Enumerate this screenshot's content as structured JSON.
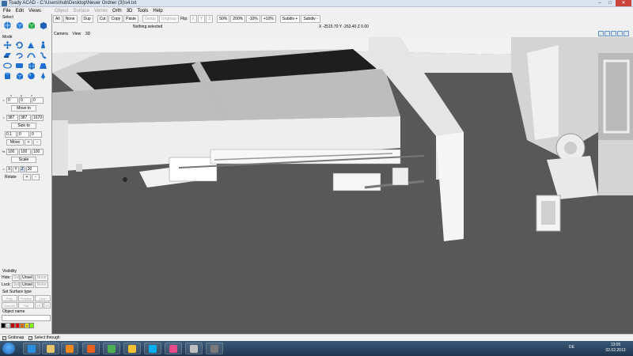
{
  "window": {
    "title": "Toady ACAD - C:\\Users\\hub\\Desktop\\Neuer Ordner (3)\\s4.txt",
    "minimize_glyph": "–",
    "maximize_glyph": "□",
    "close_glyph": "✕"
  },
  "menu": {
    "items": [
      {
        "label": "File",
        "enabled": true
      },
      {
        "label": "Edit",
        "enabled": true
      },
      {
        "label": "Views",
        "enabled": true
      },
      {
        "label": "Object",
        "enabled": false
      },
      {
        "label": "Surface",
        "enabled": false
      },
      {
        "label": "Vertex",
        "enabled": false
      },
      {
        "label": "Orth",
        "enabled": true
      },
      {
        "label": "3D",
        "enabled": true
      },
      {
        "label": "Tools",
        "enabled": true
      },
      {
        "label": "Help",
        "enabled": true
      }
    ]
  },
  "toolbar": {
    "all": "All",
    "none": "None",
    "dup": "Dup",
    "cut": "Cut",
    "copy": "Copy",
    "paste": "Paste",
    "group": "Group",
    "ungroup": "Ungroup",
    "flip_label": "Flip:",
    "flip_x": "X",
    "flip_y": "Y",
    "flip_z": "Z",
    "zoom_50": "50%",
    "zoom_200": "200%",
    "zoom_minus10": "-10%",
    "zoom_plus10": "+10%",
    "subdiv_plus": "Subdiv +",
    "subdiv_minus": "Subdiv -"
  },
  "status": {
    "selection": "Nothing selected",
    "coords": "X -2515.70  Y -263.40  Z 0.00"
  },
  "left_panel": {
    "select_title": "Select",
    "mode_title": "Mode",
    "axis": {
      "x": "x",
      "y": "y",
      "z": "z"
    },
    "move_to": {
      "x": "0",
      "y": "0",
      "z": "0",
      "button": "Move to"
    },
    "size_to": {
      "x": "387",
      "y": "387",
      "z": "1670",
      "button": "Size to"
    },
    "move": {
      "x": "0.1",
      "y": "0",
      "z": "0",
      "button": "Move",
      "plus": "+",
      "minus": "-"
    },
    "scale": {
      "prefix": "%",
      "x": "100",
      "y": "100",
      "z": "100",
      "button": "Scale"
    },
    "rotate": {
      "axes": [
        "X",
        "Y",
        "Z"
      ],
      "active_axis": "Z",
      "value": "30",
      "button": "Rotate",
      "plus": "+",
      "minus": "-"
    },
    "visibility_title": "Visibility",
    "hide_label": "Hide:",
    "lock_label": "Lock:",
    "sel": "Sel",
    "unsel": "Unsel",
    "none": "None",
    "surface_title": "Set Surface type",
    "surface_types": [
      "Poly",
      "Polyline",
      "Line",
      "Smooth",
      "Flat",
      "1S",
      "2S"
    ],
    "object_name_title": "Object name",
    "colors": [
      {
        "label": "",
        "hex": "#000000"
      },
      {
        "label": "1",
        "hex": "#ffffff"
      },
      {
        "label": "",
        "hex": "#c00000"
      },
      {
        "label": "3",
        "hex": "#ff0000"
      },
      {
        "label": "4",
        "hex": "#ff8000"
      },
      {
        "label": "5",
        "hex": "#ffff00"
      },
      {
        "label": "",
        "hex": "#80ff00"
      }
    ]
  },
  "viewport": {
    "menu": [
      "Camera",
      "View",
      "3D"
    ],
    "background": "#585858"
  },
  "bottom": {
    "gridsnap": "Gridsnap",
    "select_through": "Select through"
  },
  "taskbar": {
    "apps": [
      {
        "name": "ie-icon",
        "color": "#2a8ee0"
      },
      {
        "name": "explorer-icon",
        "color": "#e7c46a"
      },
      {
        "name": "media-player-icon",
        "color": "#f08a20"
      },
      {
        "name": "firefox-icon",
        "color": "#e8621f"
      },
      {
        "name": "chrome-icon",
        "color": "#4caf50"
      },
      {
        "name": "app-yellow-icon",
        "color": "#f2c230"
      },
      {
        "name": "skype-icon",
        "color": "#00aff0"
      },
      {
        "name": "app-pink-icon",
        "color": "#e84a8a"
      },
      {
        "name": "app-gray-icon",
        "color": "#c0c0c0"
      },
      {
        "name": "app-dark-icon",
        "color": "#7a7a7a"
      }
    ],
    "language": "DE",
    "time": "13:05",
    "date": "02.02.2013"
  }
}
